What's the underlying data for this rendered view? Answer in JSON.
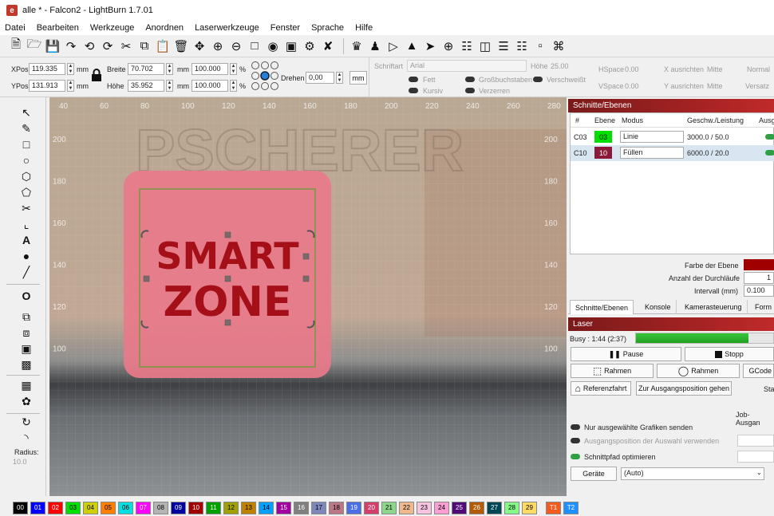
{
  "window": {
    "title": "alle * - Falcon2 - LightBurn 1.7.01"
  },
  "menu": [
    "Datei",
    "Bearbeiten",
    "Werkzeuge",
    "Anordnen",
    "Laserwerkzeuge",
    "Fenster",
    "Sprache",
    "Hilfe"
  ],
  "toolbar_icons": [
    "new-file-icon",
    "open-file-icon",
    "save-icon",
    "export-icon",
    "undo-icon",
    "redo-icon",
    "cut-icon",
    "copy-icon",
    "paste-icon",
    "delete-icon",
    "move-icon",
    "zoom-in-icon",
    "zoom-out-icon",
    "zoom-frame-icon",
    "camera-icon",
    "monitor-icon",
    "settings-icon",
    "tools-icon",
    "group-icon",
    "user-icon",
    "mirror-h-icon",
    "mirror-v-icon",
    "send-icon",
    "target-icon",
    "align-icon",
    "distribute-icon",
    "align-h-icon",
    "align-v-icon",
    "space-icon",
    "center-icon"
  ],
  "numeric": {
    "xpos_label": "XPos",
    "xpos": "119.335",
    "ypos_label": "YPos",
    "ypos": "131.913",
    "unit": "mm",
    "width_label": "Breite",
    "width": "70.702",
    "height_label": "Höhe",
    "height": "35.952",
    "scale_x": "100.000",
    "scale_y": "100.000",
    "percent": "%",
    "rotate_label": "Drehen",
    "rotate": "0,00",
    "rotate_unit": "mm"
  },
  "text_options": {
    "font_label": "Schriftart",
    "font": "Arial",
    "height_label": "Höhe",
    "height": "25.00",
    "hspace_label": "HSpace",
    "hspace": "0.00",
    "vspace_label": "VSpace",
    "vspace": "0.00",
    "xalign_label": "X ausrichten",
    "xalign": "Mitte",
    "yalign_label": "Y ausrichten",
    "yalign": "Mitte",
    "normal": "Normal",
    "offset": "Versatz",
    "bold": "Fett",
    "italic": "Kursiv",
    "caps": "Großbuchstaben",
    "distort": "Verzerren",
    "welded": "Verschweißt"
  },
  "left_tool_icons": [
    "select-icon",
    "pen-icon",
    "rectangle-icon",
    "ellipse-icon",
    "polygon-icon",
    "edit-nodes-icon",
    "cut-shapes-icon",
    "bezier-icon",
    "text-icon",
    "position-icon",
    "measure-icon",
    "offset-icon",
    "weld-icon",
    "boolean-union-icon",
    "boolean-subtract-icon",
    "boolean-intersect-icon",
    "grid-array-icon",
    "circular-array-icon",
    "corner-icon",
    "round-corner-icon"
  ],
  "radius": {
    "label": "Radius:",
    "value": "10.0"
  },
  "canvas": {
    "x_ticks": [
      "40",
      "60",
      "80",
      "100",
      "120",
      "140",
      "160",
      "180",
      "200",
      "220",
      "240",
      "260",
      "280"
    ],
    "y_ticks": [
      "200",
      "180",
      "160",
      "140",
      "120",
      "100"
    ],
    "design_lines": [
      "SMART",
      "ZONE"
    ],
    "wall_text": "PSCHERER"
  },
  "palette": [
    {
      "label": "00",
      "color": "#000000",
      "text": "#ffffff"
    },
    {
      "label": "01",
      "color": "#0000ff",
      "text": "#ffffff"
    },
    {
      "label": "02",
      "color": "#ff0000",
      "text": "#ffffff"
    },
    {
      "label": "03",
      "color": "#00e000",
      "text": "#000000"
    },
    {
      "label": "04",
      "color": "#d0d000",
      "text": "#000000"
    },
    {
      "label": "05",
      "color": "#ff8000",
      "text": "#000000"
    },
    {
      "label": "06",
      "color": "#00e0e0",
      "text": "#000000"
    },
    {
      "label": "07",
      "color": "#ff00ff",
      "text": "#ffffff"
    },
    {
      "label": "08",
      "color": "#b4b4b4",
      "text": "#000000"
    },
    {
      "label": "09",
      "color": "#0000a0",
      "text": "#ffffff"
    },
    {
      "label": "10",
      "color": "#a00000",
      "text": "#ffffff"
    },
    {
      "label": "11",
      "color": "#00a000",
      "text": "#ffffff"
    },
    {
      "label": "12",
      "color": "#a0a000",
      "text": "#000000"
    },
    {
      "label": "13",
      "color": "#c08000",
      "text": "#000000"
    },
    {
      "label": "14",
      "color": "#00a0ff",
      "text": "#000000"
    },
    {
      "label": "15",
      "color": "#a000a0",
      "text": "#ffffff"
    },
    {
      "label": "16",
      "color": "#808080",
      "text": "#ffffff"
    },
    {
      "label": "17",
      "color": "#7d87b9",
      "text": "#000000"
    },
    {
      "label": "18",
      "color": "#bb7784",
      "text": "#000000"
    },
    {
      "label": "19",
      "color": "#4a6fe3",
      "text": "#ffffff"
    },
    {
      "label": "20",
      "color": "#d33f6a",
      "text": "#ffffff"
    },
    {
      "label": "21",
      "color": "#8cd78c",
      "text": "#000000"
    },
    {
      "label": "22",
      "color": "#f0b98d",
      "text": "#000000"
    },
    {
      "label": "23",
      "color": "#f6c4e1",
      "text": "#000000"
    },
    {
      "label": "24",
      "color": "#fa9ed4",
      "text": "#000000"
    },
    {
      "label": "25",
      "color": "#500a78",
      "text": "#ffffff"
    },
    {
      "label": "26",
      "color": "#b45a00",
      "text": "#ffffff"
    },
    {
      "label": "27",
      "color": "#004754",
      "text": "#ffffff"
    },
    {
      "label": "28",
      "color": "#86fa88",
      "text": "#000000"
    },
    {
      "label": "29",
      "color": "#ffdb66",
      "text": "#000000"
    },
    {
      "label": "T1",
      "color": "#f35c1e",
      "text": "#ffffff"
    },
    {
      "label": "T2",
      "color": "#1e90ff",
      "text": "#ffffff"
    }
  ],
  "layers_panel": {
    "title": "Schnitte/Ebenen",
    "headers": [
      "#",
      "Ebene",
      "Modus",
      "Geschw./Leistung",
      "Ausg"
    ],
    "rows": [
      {
        "num": "C03",
        "layer": "03",
        "color": "#00e000",
        "mode": "Linie",
        "speed_power": "3000.0 / 50.0"
      },
      {
        "num": "C10",
        "layer": "10",
        "color": "#8b1a3a",
        "mode": "Füllen",
        "speed_power": "6000.0 / 20.0"
      }
    ],
    "layer_color_label": "Farbe der Ebene",
    "passes_label": "Anzahl der Durchläufe",
    "passes": "1",
    "interval_label": "Intervall (mm)",
    "interval": "0.100",
    "tabs": [
      "Schnitte/Ebenen",
      "Konsole",
      "Kamerasteuerung",
      "Form"
    ]
  },
  "laser_panel": {
    "title": "Laser",
    "status": "Busy : 1:44 (2:37)",
    "progress": 0.82,
    "pause": "Pause",
    "stop": "Stopp",
    "frame1": "Rahmen",
    "frame2": "Rahmen",
    "gcode": "GCode",
    "home": "Referenzfahrt",
    "goto_origin": "Zur Ausgangsposition gehen",
    "start_trunc": "Sta",
    "job_origin": "Job-Ausgan",
    "send_selected": "Nur ausgewählte Grafiken senden",
    "use_selection_origin": "Ausgangsposition der Auswahl verwenden",
    "optimize": "Schnittpfad optimieren",
    "devices_label": "Geräte",
    "device": "(Auto)"
  }
}
